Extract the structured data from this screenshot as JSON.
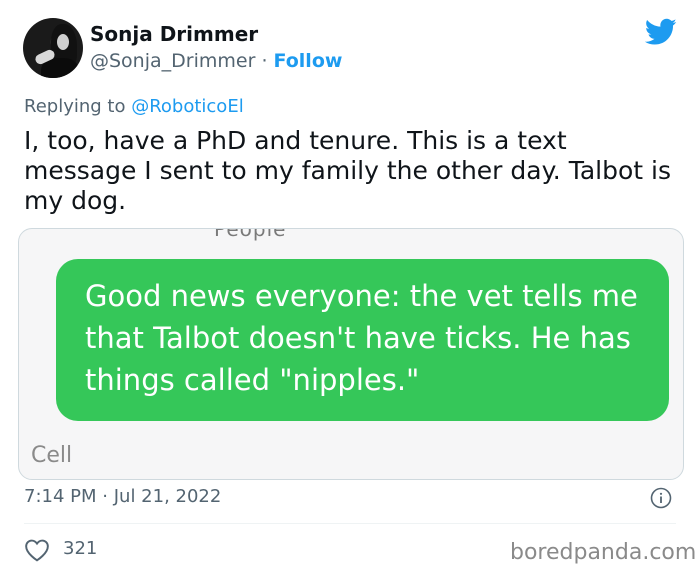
{
  "author": {
    "name": "Sonja Drimmer",
    "handle": "@Sonja_Drimmer",
    "separator": "·",
    "follow_label": "Follow"
  },
  "reply": {
    "prefix": "Replying to ",
    "mention": "@RoboticoEl"
  },
  "tweet": {
    "text": "I, too, have a PhD and tenure. This is a text message I sent to my family the other day. Talbot is my dog."
  },
  "media": {
    "cut_off_header": "People",
    "message_text": "Good news everyone: the vet tells me that Talbot doesn't have ticks. He has things called \"nipples.\"",
    "cell_label": "Cell"
  },
  "meta": {
    "time": "7:14 PM",
    "separator": "·",
    "date": "Jul 21, 2022"
  },
  "engagement": {
    "likes": "321"
  },
  "watermark": "boredpanda.com",
  "icons": [
    "twitter-bird-icon",
    "info-icon",
    "heart-icon"
  ],
  "colors": {
    "accent": "#1d9bf0",
    "bubble": "#35c759",
    "secondary_text": "#536471"
  }
}
